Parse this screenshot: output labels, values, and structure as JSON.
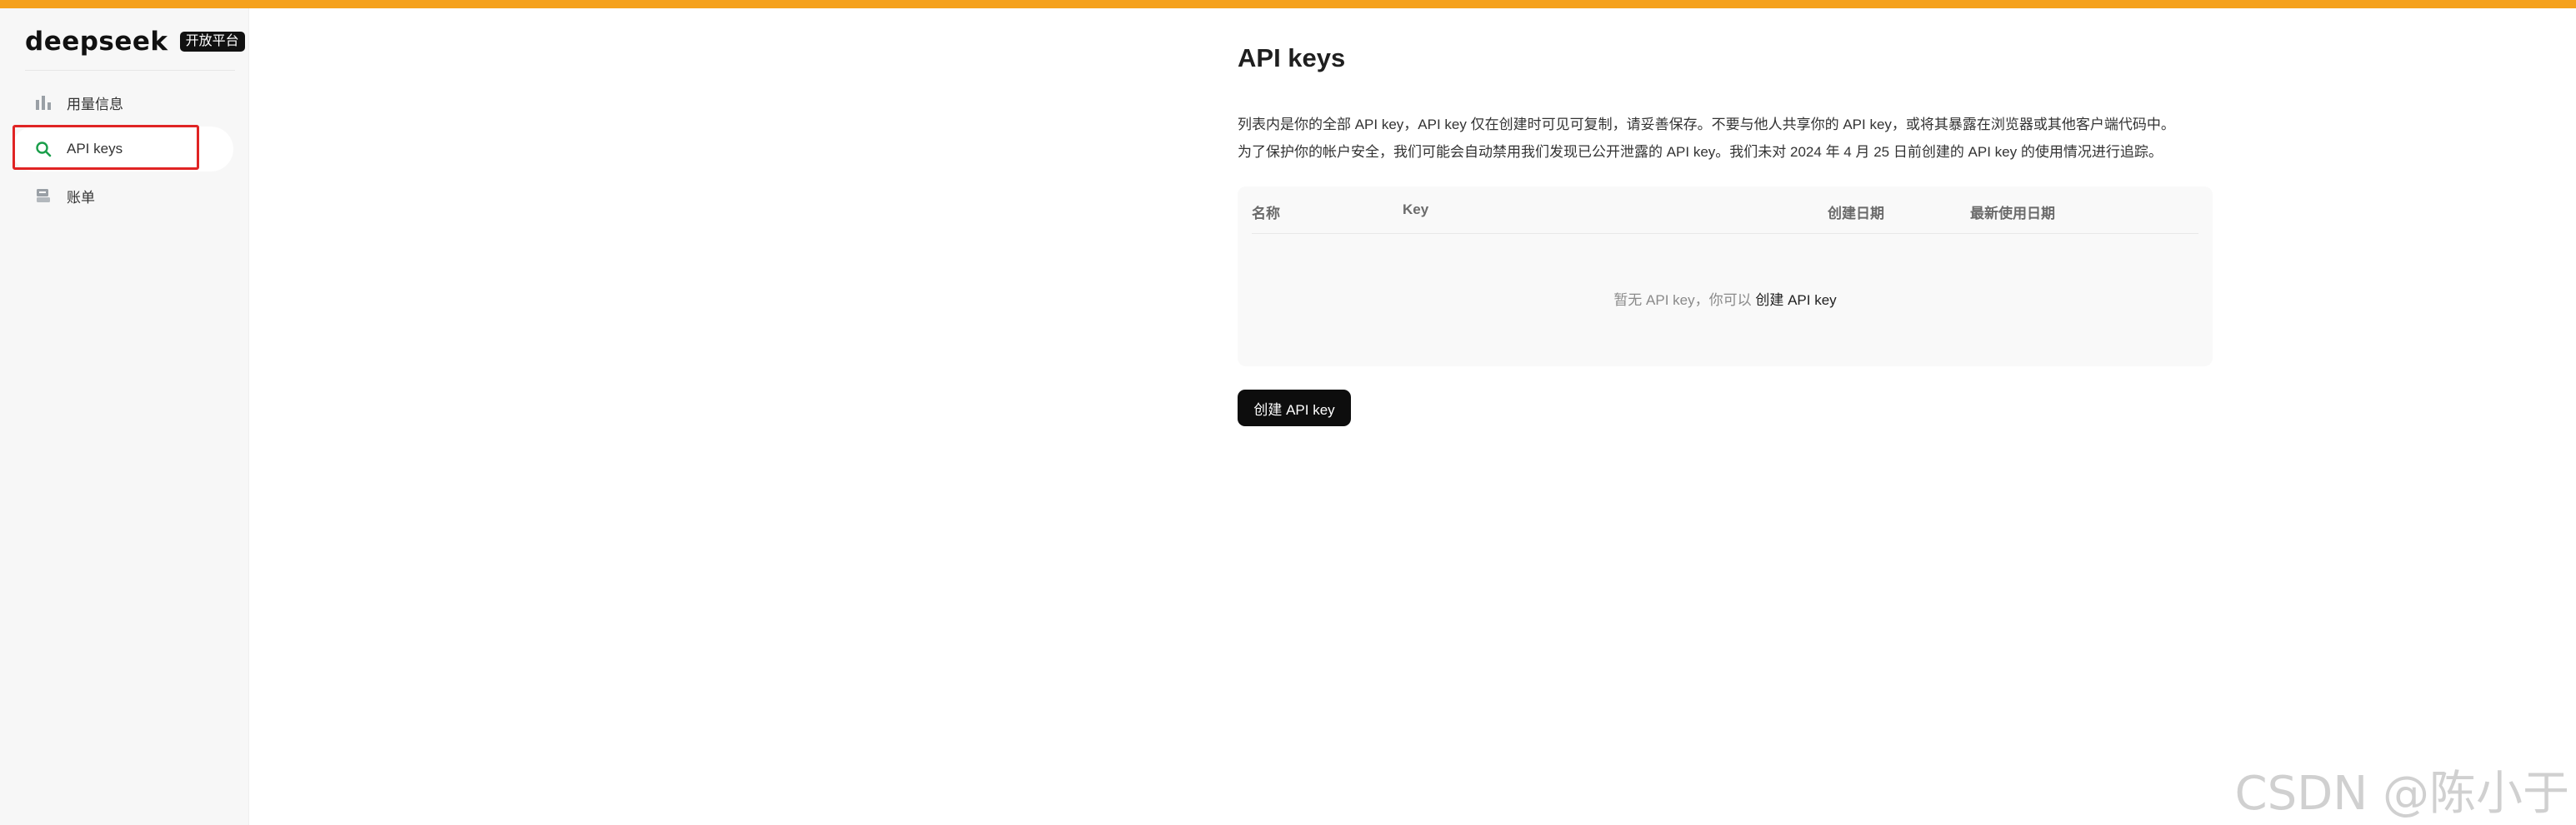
{
  "brand": {
    "logo_text": "deepseek",
    "badge": "开放平台"
  },
  "sidebar": {
    "items": [
      {
        "label": "用量信息",
        "icon": "bar-chart-icon"
      },
      {
        "label": "API keys",
        "icon": "search-icon",
        "active": true
      },
      {
        "label": "账单",
        "icon": "bill-icon"
      }
    ]
  },
  "main": {
    "title": "API keys",
    "description": [
      "列表内是你的全部 API key，API key 仅在创建时可见可复制，请妥善保存。不要与他人共享你的 API key，或将其暴露在浏览器或其他客户端代码中。",
      "为了保护你的帐户安全，我们可能会自动禁用我们发现已公开泄露的 API key。我们未对 2024 年 4 月 25 日前创建的 API key 的使用情况进行追踪。"
    ],
    "table": {
      "columns": [
        "名称",
        "Key",
        "创建日期",
        "最新使用日期"
      ],
      "empty_text": "暂无 API key，你可以",
      "empty_link": "创建 API key"
    },
    "create_button": "创建 API key"
  },
  "watermark": "CSDN @陈小于",
  "colors": {
    "topbar": "#f5a11c",
    "accent_green": "#1a9e4a",
    "highlight_red": "#e02424",
    "button_bg": "#0d0d0d"
  }
}
